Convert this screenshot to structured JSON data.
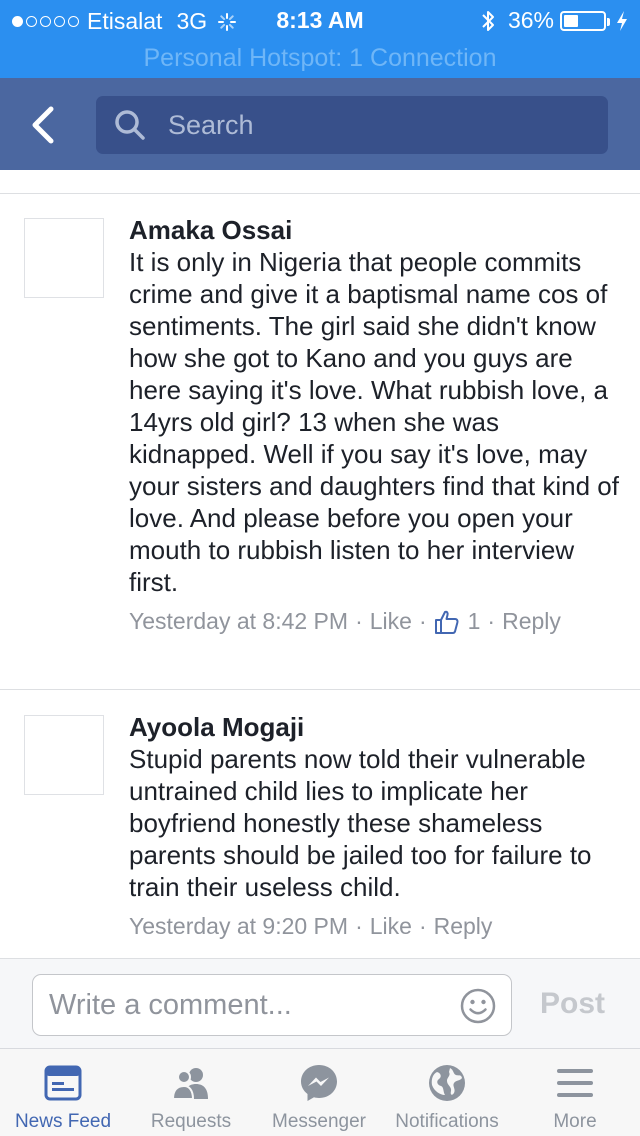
{
  "status_bar": {
    "carrier": "Etisalat",
    "network": "3G",
    "time": "8:13 AM",
    "battery": "36%",
    "battery_level": 0.36
  },
  "hotspot": {
    "text": "Personal Hotspot: 1 Connection"
  },
  "nav": {
    "search_placeholder": "Search"
  },
  "comments": [
    {
      "author": "Amaka Ossai",
      "text": "It is only in Nigeria that people commits crime and give it a baptismal name cos of sentiments. The girl said she didn't know how she got to Kano and you guys are here saying it's love. What rubbish love, a 14yrs old girl? 13 when she was kidnapped. Well if you say it's love, may your sisters and daughters find that kind of love. And please before you open your mouth to rubbish listen to her interview first.",
      "time": "Yesterday at 8:42 PM",
      "like_label": "Like",
      "like_count": "1",
      "reply_label": "Reply",
      "separator": "·"
    },
    {
      "author": "Ayoola Mogaji",
      "text": "Stupid parents now told their vulnerable untrained child lies to implicate her boyfriend honestly these shameless parents should be jailed too for failure to train their useless child.",
      "time": "Yesterday at 9:20 PM",
      "like_label": "Like",
      "reply_label": "Reply",
      "separator": "·"
    }
  ],
  "composer": {
    "placeholder": "Write a comment...",
    "post_label": "Post"
  },
  "tabbar": {
    "tabs": [
      {
        "label": "News Feed",
        "icon": "news-feed-icon",
        "active": true
      },
      {
        "label": "Requests",
        "icon": "friend-requests-icon",
        "active": false
      },
      {
        "label": "Messenger",
        "icon": "messenger-icon",
        "active": false
      },
      {
        "label": "Notifications",
        "icon": "globe-icon",
        "active": false
      },
      {
        "label": "More",
        "icon": "hamburger-menu-icon",
        "active": false
      }
    ]
  },
  "colors": {
    "status_bar_bg": "#2b8ff0",
    "nav_bg": "#4b67a0",
    "search_bg": "#38508a",
    "active_tab": "#4267b2",
    "inactive_tab": "#8d949e",
    "meta_text": "#90949c"
  }
}
